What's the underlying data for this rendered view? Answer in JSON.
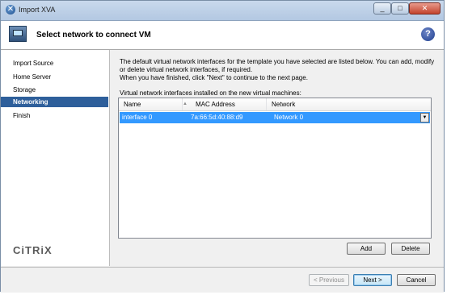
{
  "window": {
    "title": "Import XVA"
  },
  "header": {
    "title": "Select network to connect VM",
    "help_glyph": "?"
  },
  "sidebar": {
    "items": [
      {
        "label": "Import Source",
        "active": false
      },
      {
        "label": "Home Server",
        "active": false
      },
      {
        "label": "Storage",
        "active": false
      },
      {
        "label": "Networking",
        "active": true
      },
      {
        "label": "Finish",
        "active": false
      }
    ],
    "logo": "CiTRiX"
  },
  "main": {
    "description_1": "The default virtual network interfaces for the template you have selected are listed below. You can add, modify or delete virtual network interfaces, if required.",
    "description_2": "When you have finished, click \"Next\" to continue to the next page.",
    "list_caption": "Virtual network interfaces installed on the new virtual machines:",
    "table": {
      "columns": [
        "Name",
        "MAC Address",
        "Network"
      ],
      "rows": [
        {
          "name": "interface 0",
          "mac": "7a:66:5d:40:88:d9",
          "network": "Network 0",
          "selected": true
        }
      ]
    },
    "add_label": "Add",
    "delete_label": "Delete"
  },
  "footer": {
    "previous_label": "< Previous",
    "next_label": "Next >",
    "cancel_label": "Cancel"
  },
  "colors": {
    "selection": "#3399ff",
    "nav_active": "#2e5f9b"
  }
}
